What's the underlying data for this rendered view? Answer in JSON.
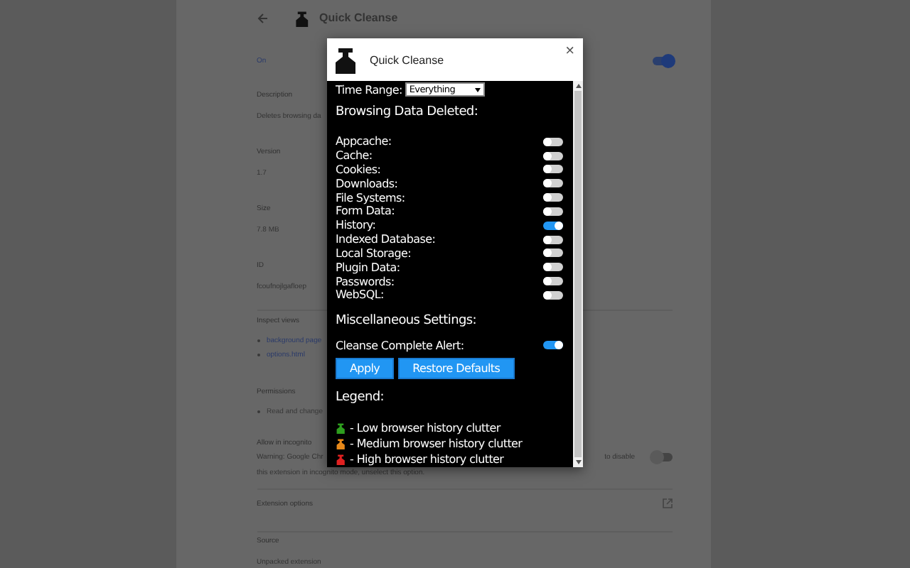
{
  "page": {
    "title": "Quick Cleanse",
    "details": [
      {
        "kind": "toggle",
        "label": "On",
        "on": true
      },
      {
        "kind": "field",
        "label": "Description",
        "value": "Deletes browsing da"
      },
      {
        "kind": "field",
        "label": "Version",
        "value": "1.7"
      },
      {
        "kind": "field",
        "label": "Size",
        "value": "7.8 MB"
      },
      {
        "kind": "field",
        "label": "ID",
        "value": "fcoufnojlgafloep"
      },
      {
        "kind": "list",
        "label": "Inspect views",
        "items": [
          {
            "text": "background page",
            "link": true
          },
          {
            "text": "options.html",
            "link": true
          }
        ]
      },
      {
        "kind": "list",
        "label": "Permissions",
        "items": [
          {
            "text": "Read and change",
            "link": false
          }
        ]
      },
      {
        "kind": "warning",
        "label": "Allow in incognito",
        "lines": [
          "Warning: Google Chr",
          "this extension in incognito mode, unselect this option."
        ],
        "trailing": "to disable",
        "on": false
      },
      {
        "kind": "link",
        "label": "Extension options"
      },
      {
        "kind": "field",
        "label": "Source",
        "value": "Unpacked extension"
      }
    ]
  },
  "popup": {
    "title": "Quick Cleanse",
    "close": "×",
    "time_range": {
      "label": "Time Range:",
      "value": "Everything"
    },
    "data_heading": "Browsing Data Deleted:",
    "options": [
      {
        "label": "Appcache:",
        "on": false
      },
      {
        "label": "Cache:",
        "on": false
      },
      {
        "label": "Cookies:",
        "on": false
      },
      {
        "label": "Downloads:",
        "on": false
      },
      {
        "label": "File Systems:",
        "on": false
      },
      {
        "label": "Form Data:",
        "on": false
      },
      {
        "label": "History:",
        "on": true
      },
      {
        "label": "Indexed Database:",
        "on": false
      },
      {
        "label": "Local Storage:",
        "on": false
      },
      {
        "label": "Plugin Data:",
        "on": false
      },
      {
        "label": "Passwords:",
        "on": false
      },
      {
        "label": "WebSQL:",
        "on": false
      }
    ],
    "misc_heading": "Miscellaneous Settings:",
    "misc": [
      {
        "label": "Cleanse Complete Alert:",
        "on": true
      }
    ],
    "buttons": [
      "Apply",
      "Restore Defaults"
    ],
    "legend_heading": "Legend:",
    "legend": [
      {
        "color": "#2e9e1e",
        "text": "- Low browser history clutter"
      },
      {
        "color": "#e8891a",
        "text": "- Medium browser history clutter"
      },
      {
        "color": "#e02020",
        "text": "- High browser history clutter"
      }
    ]
  }
}
